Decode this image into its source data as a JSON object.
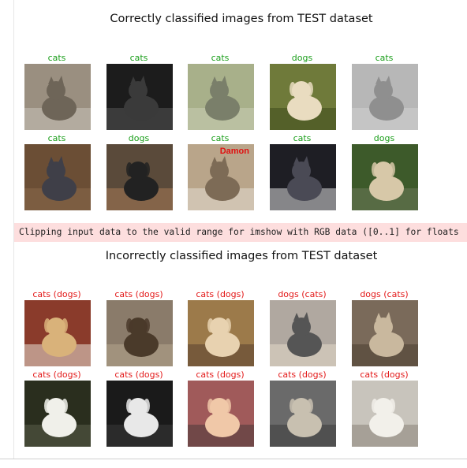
{
  "figures": {
    "correct": {
      "title": "Correctly classified images from TEST dataset",
      "label_color": "#1a9e1a",
      "rows": [
        [
          {
            "label": "cats",
            "icon": "cat-photo"
          },
          {
            "label": "cats",
            "icon": "cat-photo"
          },
          {
            "label": "cats",
            "icon": "cat-photo"
          },
          {
            "label": "dogs",
            "icon": "dog-photo"
          },
          {
            "label": "cats",
            "icon": "cat-photo"
          }
        ],
        [
          {
            "label": "cats",
            "icon": "cat-photo"
          },
          {
            "label": "dogs",
            "icon": "dog-photo"
          },
          {
            "label": "cats",
            "icon": "cat-photo",
            "caption": "Damon"
          },
          {
            "label": "cats",
            "icon": "cat-photo"
          },
          {
            "label": "dogs",
            "icon": "dog-photo"
          }
        ]
      ]
    },
    "incorrect": {
      "title": "Incorrectly classified images from TEST dataset",
      "label_color": "#e31a1a",
      "rows": [
        [
          {
            "label": "cats (dogs)",
            "icon": "dog-photo"
          },
          {
            "label": "cats (dogs)",
            "icon": "dog-photo"
          },
          {
            "label": "cats (dogs)",
            "icon": "dog-photo"
          },
          {
            "label": "dogs (cats)",
            "icon": "cat-photo"
          },
          {
            "label": "dogs (cats)",
            "icon": "cat-photo"
          }
        ],
        [
          {
            "label": "cats (dogs)",
            "icon": "dog-photo"
          },
          {
            "label": "cats (dogs)",
            "icon": "dog-photo"
          },
          {
            "label": "cats (dogs)",
            "icon": "dog-photo"
          },
          {
            "label": "cats (dogs)",
            "icon": "dog-photo"
          },
          {
            "label": "cats (dogs)",
            "icon": "dog-photo"
          }
        ]
      ]
    }
  },
  "warning": {
    "text": "Clipping input data to the valid range for imshow with RGB data ([0..1] for floats",
    "background": "#fddede"
  }
}
